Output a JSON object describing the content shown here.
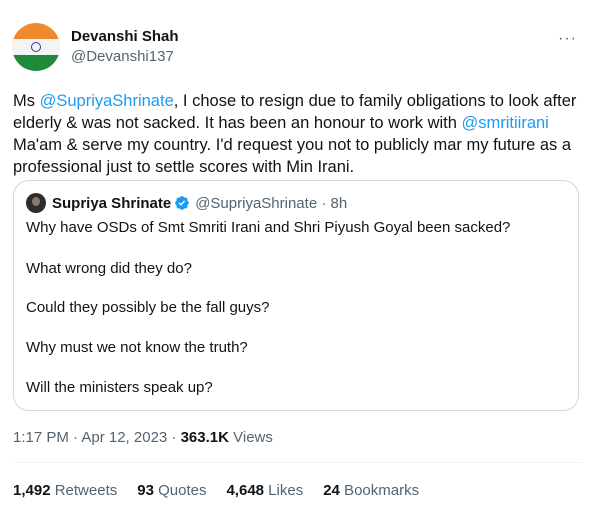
{
  "author": {
    "display_name": "Devanshi Shah",
    "handle": "@Devanshi137",
    "avatar_icon": "india-flag-avatar"
  },
  "menu_icon": "more-horizontal-icon",
  "tweet": {
    "seg1": "Ms ",
    "mention1": "@SupriyaShrinate",
    "seg2": ", I chose to resign due to family obligations to look after elderly & was not sacked. It has been an honour to work with ",
    "mention2": "@smritiirani",
    "seg3": " Ma'am & serve my country. I'd request you not to publicly mar my future as a professional just to settle scores with Min Irani."
  },
  "quote": {
    "name": "Supriya Shrinate",
    "verified_icon": "verified-badge-icon",
    "handle_time": "@SupriyaShrinate · 8h",
    "lines": [
      "Why have OSDs of Smt Smriti Irani and Shri Piyush Goyal been sacked?",
      "What wrong did they do?",
      "Could they possibly be the fall guys?",
      "Why must we not know the truth?",
      "Will the ministers speak up?"
    ]
  },
  "meta": {
    "time_date": "1:17 PM · Apr 12, 2023 · ",
    "views_count": "363.1K",
    "views_label": " Views"
  },
  "stats": {
    "retweets_count": "1,492",
    "retweets_label": " Retweets",
    "quotes_count": "93",
    "quotes_label": " Quotes",
    "likes_count": "4,648",
    "likes_label": " Likes",
    "bookmarks_count": "24",
    "bookmarks_label": " Bookmarks"
  },
  "colors": {
    "link": "#1d9bf0",
    "secondary": "#536471",
    "border": "#cfd9de"
  }
}
